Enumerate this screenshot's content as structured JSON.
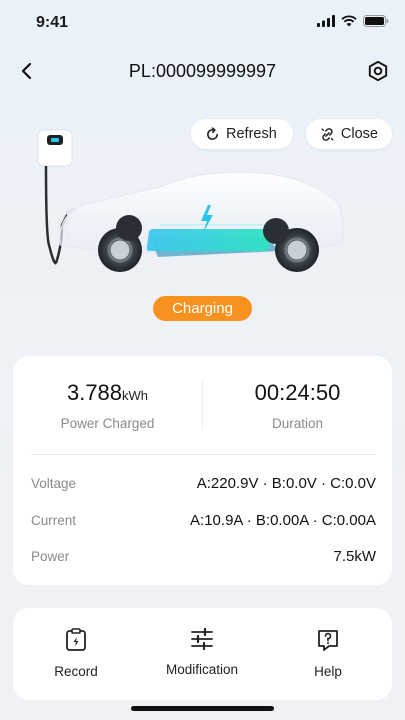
{
  "status_bar": {
    "time": "9:41"
  },
  "header": {
    "title": "PL:000099999997"
  },
  "toolbar": {
    "refresh_label": "Refresh",
    "close_label": "Close"
  },
  "charging": {
    "status": "Charging"
  },
  "stats": {
    "power_value": "3.788",
    "power_unit": "kWh",
    "power_label": "Power Charged",
    "duration_value": "00:24:50",
    "duration_label": "Duration"
  },
  "details": [
    {
      "label": "Voltage",
      "value": "A:220.9V · B:0.0V · C:0.0V"
    },
    {
      "label": "Current",
      "value": "A:10.9A · B:0.00A · C:0.00A"
    },
    {
      "label": "Power",
      "value": "7.5kW"
    }
  ],
  "actions": [
    {
      "label": "Record",
      "icon": "record-icon"
    },
    {
      "label": "Modification",
      "icon": "sliders-icon"
    },
    {
      "label": "Help",
      "icon": "help-icon"
    }
  ],
  "colors": {
    "accent": "#f7921e",
    "battery": "#2ec3e8"
  }
}
